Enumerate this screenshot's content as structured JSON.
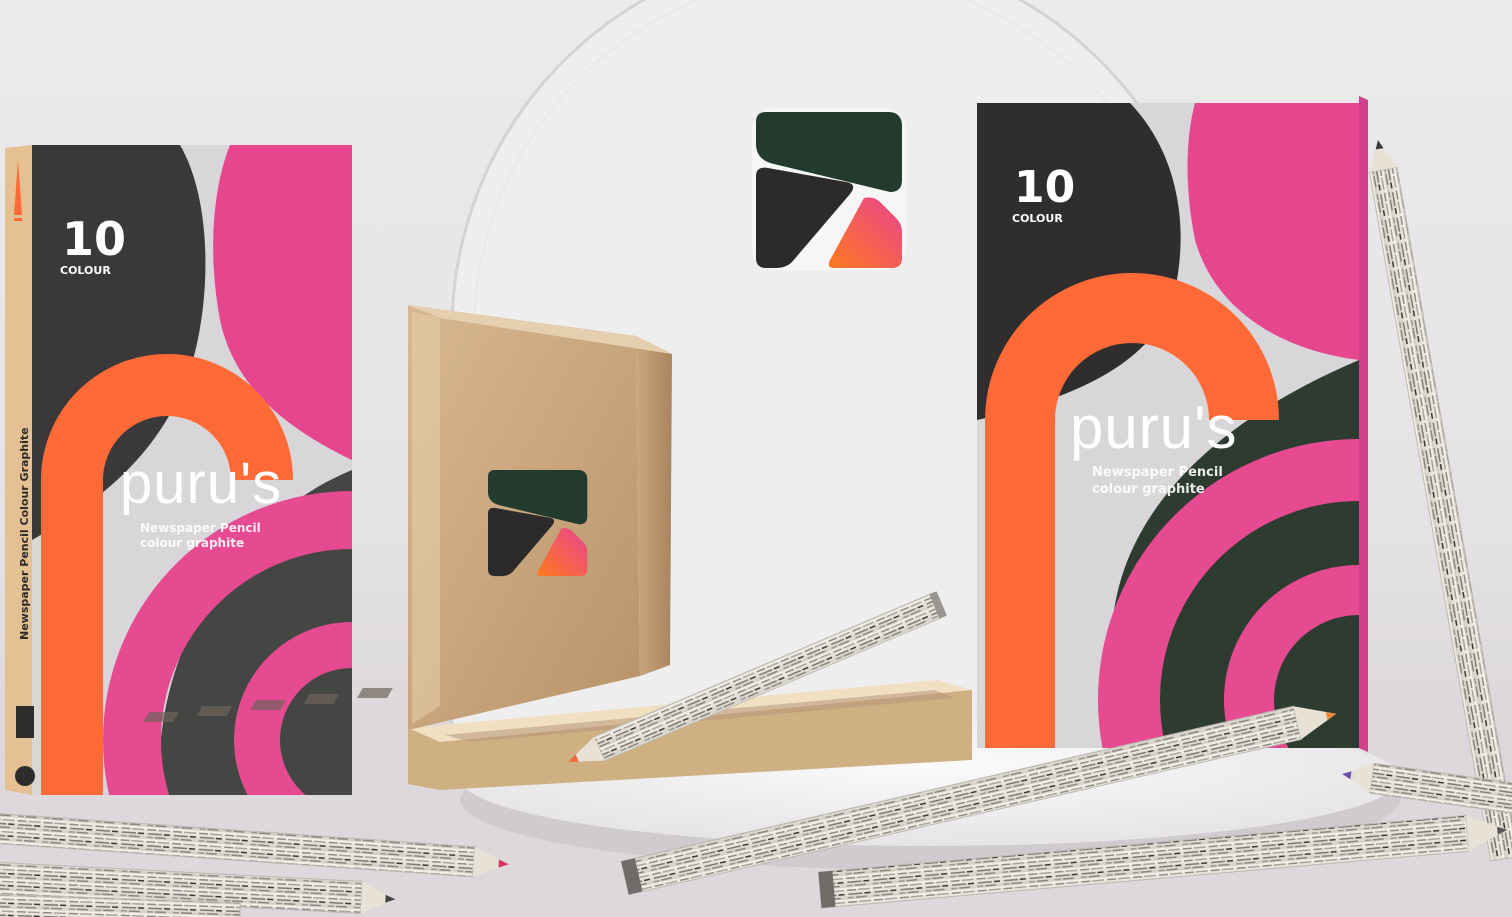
{
  "product": {
    "count": "10",
    "count_label": "COLOUR",
    "brand": "puru's",
    "tagline_1": "Newspaper Pencil",
    "tagline_2": "colour graphite",
    "spine_text": "Newspaper Pencil Colour Graphite"
  },
  "colors": {
    "pink": "#e6478d",
    "orange": "#ff6a33",
    "charcoal": "#383637",
    "dark_green": "#2c3a31",
    "light_gray": "#d8d6d9",
    "kraft": "#d6b58d"
  },
  "icons": [
    "brand-logo-icon"
  ]
}
